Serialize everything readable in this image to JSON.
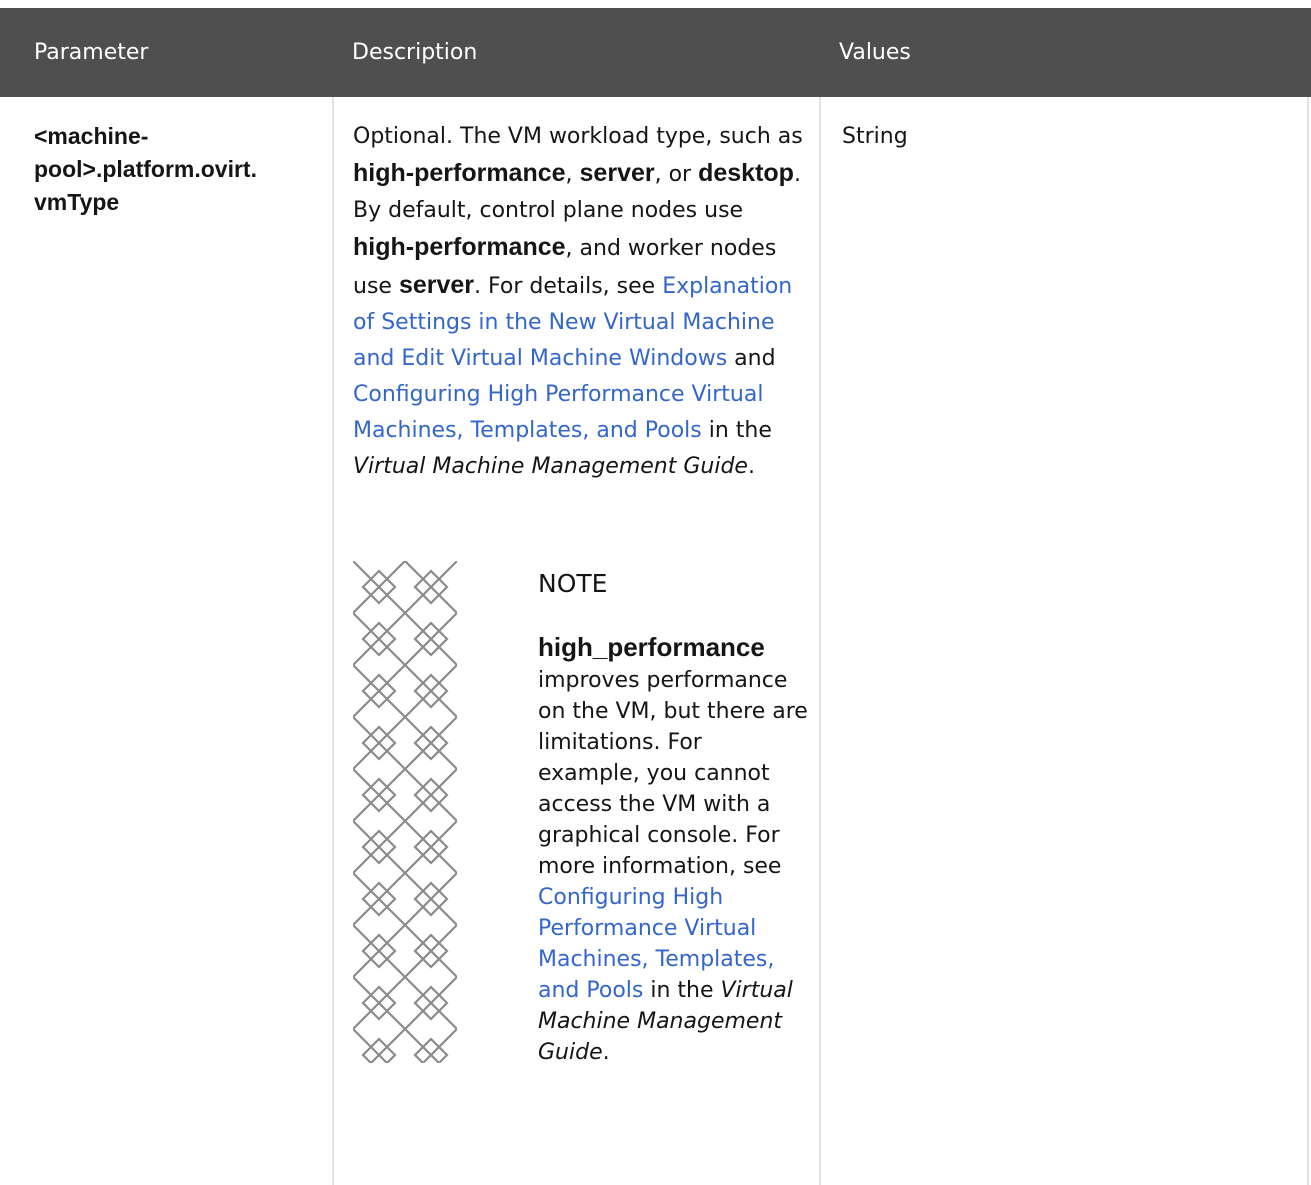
{
  "header": {
    "col1": "Parameter",
    "col2": "Description",
    "col3": "Values"
  },
  "row": {
    "parameter_line1": "<machine-",
    "parameter_line2": "pool>.platform.ovirt.",
    "parameter_line3": "vmType",
    "desc": {
      "t1": "Optional. The VM workload type, such as ",
      "b1": "high-performance",
      "t2": ", ",
      "b2": "server",
      "t3": ", or ",
      "b3": "desktop",
      "t4": ". By default, control plane nodes use ",
      "b4": "high-performance",
      "t5": ", and worker nodes use ",
      "b5": "server",
      "t6": ". For details, see ",
      "link1": "Explanation of Settings in the New Virtual Machine and Edit Virtual Machine Windows",
      "t7": " and ",
      "link2": "Configuring High Performance Virtual Machines, Templates, and Pools",
      "t8": " in the ",
      "i1": "Virtual Machine Management Guide",
      "t9": "."
    },
    "note": {
      "icon": "note-pattern-icon",
      "title": "NOTE",
      "b1": "high_performance",
      "t1": " improves performance on the VM, but there are limitations. For example, you cannot access the VM with a graphical console. For more information, see ",
      "link1": "Configuring High Performance Virtual Machines, Templates, and Pools",
      "t2": " in the ",
      "i1": "Virtual Machine Management Guide",
      "t3": "."
    },
    "value": "String"
  },
  "colors": {
    "header_bg": "#4f4f4f",
    "link": "#3366cc",
    "border": "#e3e3e3"
  }
}
